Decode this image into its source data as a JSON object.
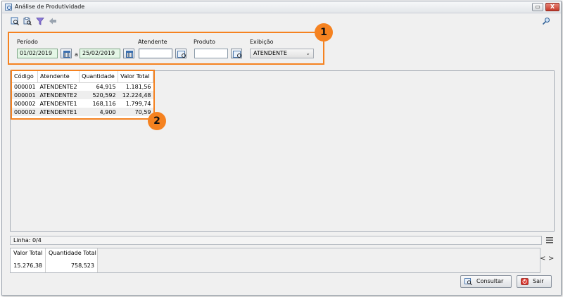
{
  "window": {
    "title": "Análise de Produtividade",
    "controls": {
      "minimize": "▭",
      "restore": "⧉",
      "close": "X"
    }
  },
  "toolbar": {
    "icons": [
      "view-report-icon",
      "print-preview-icon",
      "filter-icon",
      "back-arrow-icon"
    ],
    "search_icon": "search-icon"
  },
  "filters": {
    "periodo_label": "Período",
    "date_from": "01/02/2019",
    "date_separator": "a",
    "date_to": "25/02/2019",
    "atendente_label": "Atendente",
    "atendente_value": "",
    "produto_label": "Produto",
    "produto_value": "",
    "exibicao_label": "Exibição",
    "exibicao_value": "ATENDENTE"
  },
  "callouts": {
    "one": "1",
    "two": "2"
  },
  "table": {
    "columns": [
      "Código",
      "Atendente",
      "Quantidade",
      "Valor Total"
    ],
    "rows": [
      [
        "000001",
        "ATENDENTE2",
        "64,915",
        "1.181,56"
      ],
      [
        "000001",
        "ATENDENTE2",
        "520,592",
        "12.224,48"
      ],
      [
        "000002",
        "ATENDENTE1",
        "168,116",
        "1.799,74"
      ],
      [
        "000002",
        "ATENDENTE1",
        "4,900",
        "70,59"
      ]
    ]
  },
  "status": {
    "line_text": "Linha: 0/4"
  },
  "totals": {
    "valor_total_label": "Valor Total",
    "valor_total": "15.276,38",
    "quantidade_total_label": "Quantidade Total",
    "quantidade_total": "758,523"
  },
  "nav": {
    "prev": "<",
    "next": ">"
  },
  "buttons": {
    "consultar": "Consultar",
    "sair": "Sair"
  },
  "colors": {
    "highlight": "#f58220",
    "date_field_bg": "#e4f6e6"
  }
}
